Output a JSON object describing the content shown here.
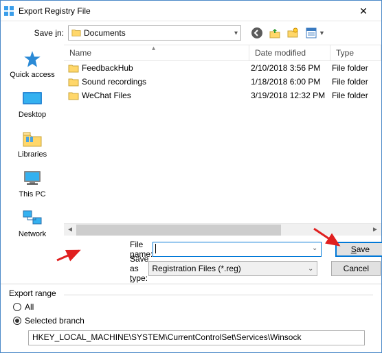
{
  "titlebar": {
    "title": "Export Registry File"
  },
  "toolbar": {
    "save_in_label": "Save in:",
    "save_in_value": "Documents"
  },
  "columns": {
    "name": "Name",
    "date": "Date modified",
    "type": "Type"
  },
  "rows": [
    {
      "name": "FeedbackHub",
      "date": "2/10/2018 3:56 PM",
      "type": "File folder"
    },
    {
      "name": "Sound recordings",
      "date": "1/18/2018 6:00 PM",
      "type": "File folder"
    },
    {
      "name": "WeChat Files",
      "date": "3/19/2018 12:32 PM",
      "type": "File folder"
    }
  ],
  "places": [
    {
      "label": "Quick access"
    },
    {
      "label": "Desktop"
    },
    {
      "label": "Libraries"
    },
    {
      "label": "This PC"
    },
    {
      "label": "Network"
    }
  ],
  "fields": {
    "file_name_label": "File name:",
    "file_name_value": "",
    "save_as_type_label": "Save as type:",
    "save_as_type_value": "Registration Files (*.reg)"
  },
  "buttons": {
    "save": "Save",
    "cancel": "Cancel"
  },
  "export": {
    "group": "Export range",
    "all": "All",
    "selected": "Selected branch",
    "branch_path": "HKEY_LOCAL_MACHINE\\SYSTEM\\CurrentControlSet\\Services\\Winsock"
  }
}
